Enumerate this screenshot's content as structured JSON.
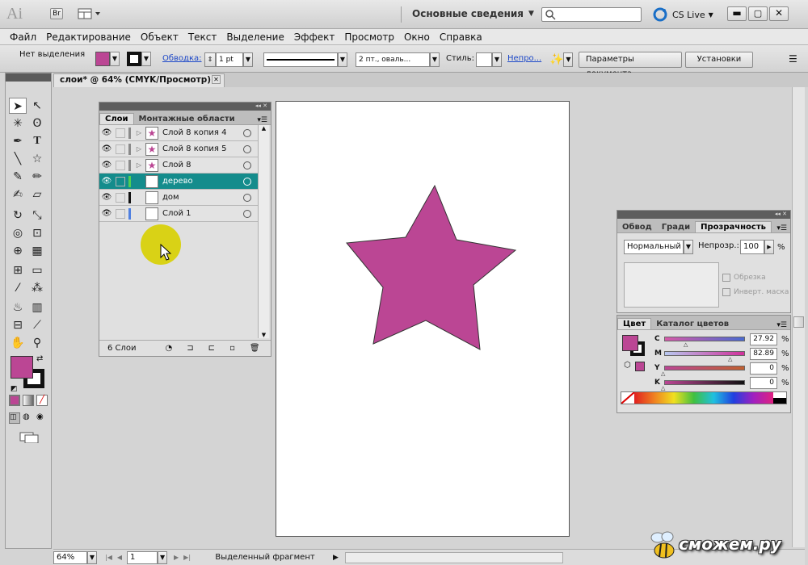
{
  "app": {
    "logo": "Ai",
    "bridge_label": "Br",
    "workspace": "Основные сведения",
    "cslive": "CS Live"
  },
  "menu": [
    "Файл",
    "Редактирование",
    "Объект",
    "Текст",
    "Выделение",
    "Эффект",
    "Просмотр",
    "Окно",
    "Справка"
  ],
  "control": {
    "selection": "Нет выделения",
    "stroke_label": "Обводка:",
    "stroke_value": "1 pt",
    "brush_value": "2 пт., оваль...",
    "style_label": "Стиль:",
    "opacity_label": "Непро...",
    "doc_params_button": "Параметры документа",
    "settings_button": "Установки",
    "fill_color": "#bb4694"
  },
  "document_tab": "слои* @ 64% (CMYK/Просмотр)",
  "layers_panel": {
    "tab_layers": "Слои",
    "tab_artboards": "Монтажные области",
    "layers": [
      {
        "name": "Слой 8 копия 4",
        "bar": "#8a8a8a",
        "thumb": "star",
        "selected": false
      },
      {
        "name": "Слой 8 копия 5",
        "bar": "#8a8a8a",
        "thumb": "star",
        "selected": false
      },
      {
        "name": "Слой 8",
        "bar": "#8a8a8a",
        "thumb": "star",
        "selected": false
      },
      {
        "name": "дерево",
        "bar": "#50d050",
        "thumb": "blank",
        "selected": true
      },
      {
        "name": "дом",
        "bar": "#111111",
        "thumb": "blank",
        "selected": false
      },
      {
        "name": "Слой 1",
        "bar": "#5080e0",
        "thumb": "blank",
        "selected": false
      }
    ],
    "count_label": "6 Слои"
  },
  "transparency_panel": {
    "tab_stroke": "Обвод",
    "tab_gradient": "Гради",
    "tab_transparency": "Прозрачность",
    "blend_mode": "Нормальный",
    "opacity_label": "Непрозр.:",
    "opacity_value": "100",
    "pct": "%",
    "clip_label": "Обрезка",
    "invert_label": "Инверт. маска"
  },
  "color_panel": {
    "tab_color": "Цвет",
    "tab_catalog": "Каталог цветов",
    "channels": [
      {
        "label": "C",
        "value": "27.92",
        "pct": "%",
        "level": 0.28
      },
      {
        "label": "M",
        "value": "82.89",
        "pct": "%",
        "level": 0.83
      },
      {
        "label": "Y",
        "value": "0",
        "pct": "%",
        "level": 0.0
      },
      {
        "label": "K",
        "value": "0",
        "pct": "%",
        "level": 0.0
      }
    ],
    "fill_color": "#bb4694"
  },
  "status": {
    "zoom": "64%",
    "page": "1",
    "mode": "Выделенный фрагмент"
  },
  "watermark": "сможем.ру",
  "star_color": "#bb4694"
}
